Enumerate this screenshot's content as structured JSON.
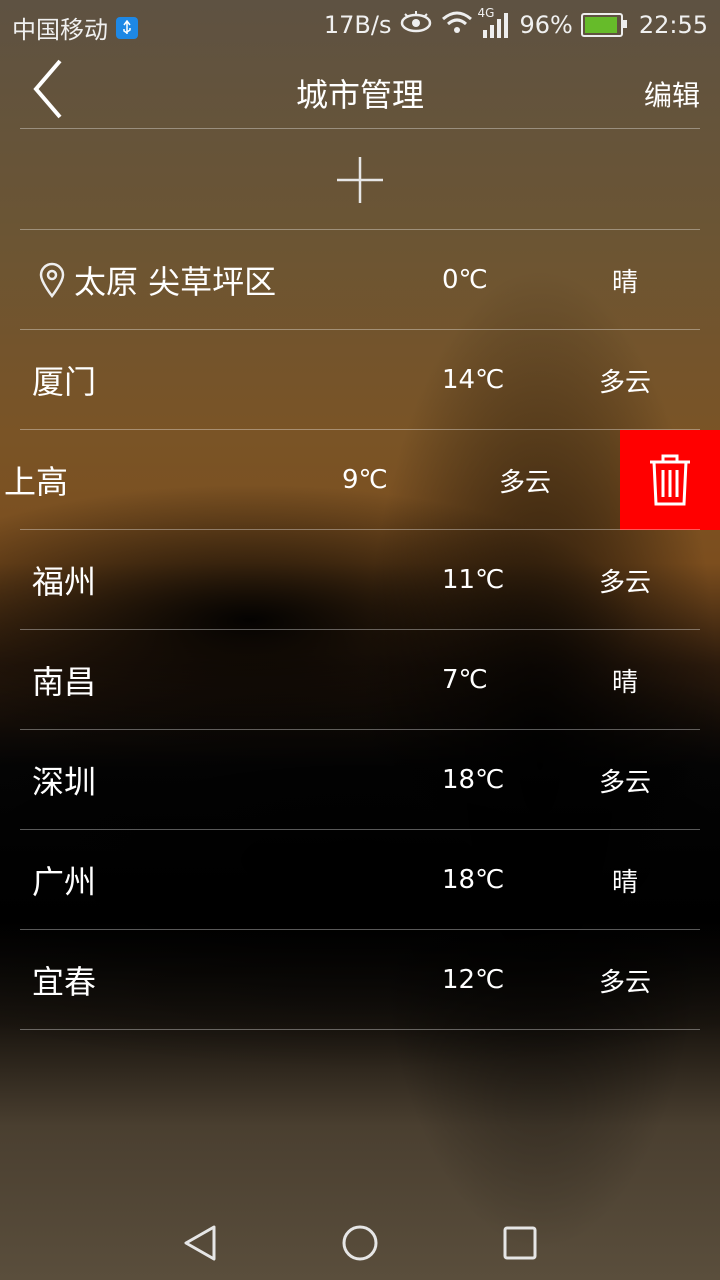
{
  "status_bar": {
    "carrier": "中国移动",
    "net_speed": "17B/s",
    "network_type": "4G",
    "battery": "96%",
    "battery_level": 0.96,
    "time": "22:55",
    "icons": [
      "usb-icon",
      "eye-icon",
      "wifi-icon",
      "signal-icon",
      "battery-charging-icon"
    ]
  },
  "header": {
    "title": "城市管理",
    "edit_label": "编辑",
    "back_icon": "chevron-left-icon"
  },
  "add_icon": "plus-icon",
  "cities": [
    {
      "name": "太原 尖草坪区",
      "temp": "0℃",
      "condition": "晴",
      "located": true
    },
    {
      "name": "厦门",
      "temp": "14℃",
      "condition": "多云"
    },
    {
      "name": "上高",
      "temp": "9℃",
      "condition": "多云",
      "swiped": true
    },
    {
      "name": "福州",
      "temp": "11℃",
      "condition": "多云"
    },
    {
      "name": "南昌",
      "temp": "7℃",
      "condition": "晴"
    },
    {
      "name": "深圳",
      "temp": "18℃",
      "condition": "多云"
    },
    {
      "name": "广州",
      "temp": "18℃",
      "condition": "晴"
    },
    {
      "name": "宜春",
      "temp": "12℃",
      "condition": "多云"
    }
  ],
  "delete_action": {
    "icon": "trash-icon",
    "color": "#ff0000"
  },
  "nav_bar": {
    "icons": [
      "back-triangle-icon",
      "home-circle-icon",
      "recents-square-icon"
    ]
  }
}
